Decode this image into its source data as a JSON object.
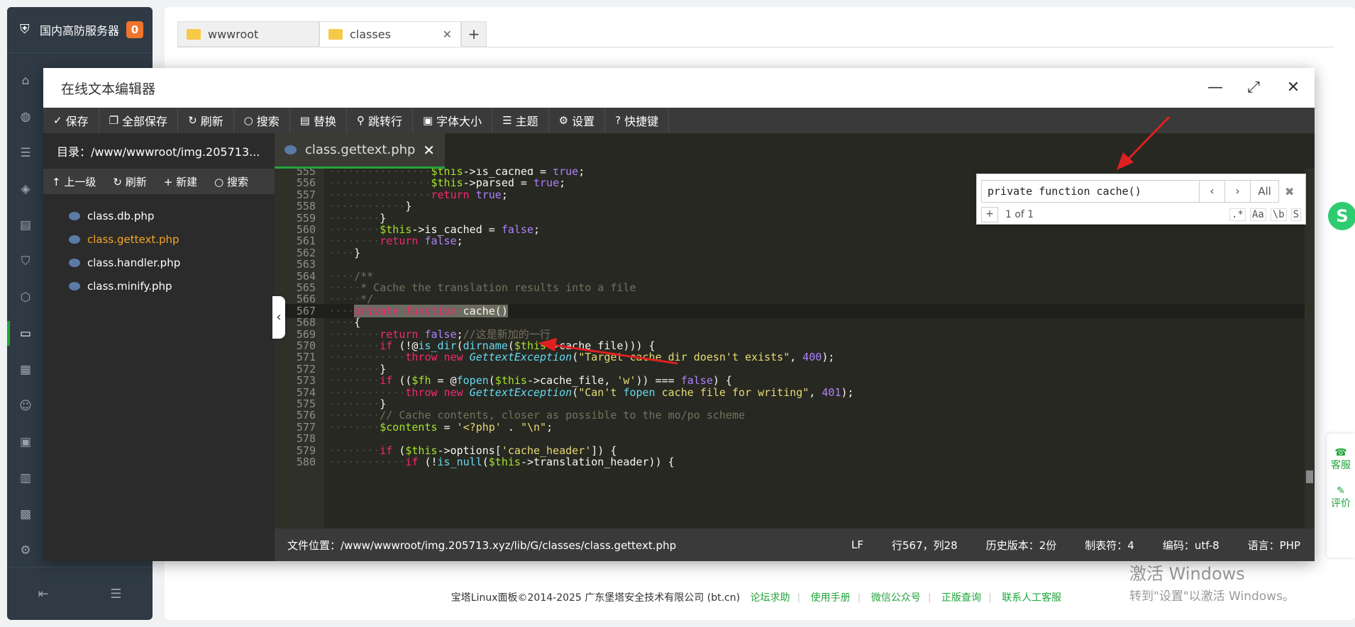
{
  "sidebar": {
    "brand_name": "国内高防服务器",
    "badge_count": "0"
  },
  "file_manager": {
    "tabs": [
      {
        "label": "wwwroot"
      },
      {
        "label": "classes"
      }
    ],
    "add_tab": "+"
  },
  "editor": {
    "title": "在线文本编辑器",
    "toolbar": {
      "save": "保存",
      "save_all": "全部保存",
      "refresh": "刷新",
      "search": "搜索",
      "replace": "替换",
      "goto_line": "跳转行",
      "font_size": "字体大小",
      "theme": "主题",
      "settings": "设置",
      "shortcuts": "快捷键"
    },
    "dir": {
      "path": "目录：/www/wwwroot/img.205713...",
      "up": "上一级",
      "refresh": "刷新",
      "new": "新建",
      "search": "搜索",
      "files": [
        "class.db.php",
        "class.gettext.php",
        "class.handler.php",
        "class.minify.php"
      ]
    },
    "active_tab": "class.gettext.php",
    "search_box": {
      "query": "private function cache()",
      "all_label": "All",
      "count": "1 of 1",
      "opt_regex": ".*",
      "opt_case": "Aa",
      "opt_word": "\\b",
      "opt_sel": "S"
    },
    "status": {
      "file_path": "文件位置：/www/wwwroot/img.205713.xyz/lib/G/classes/class.gettext.php",
      "line_ending": "LF",
      "cursor": "行567，列28",
      "history": "历史版本：2份",
      "tab_size": "制表符：4",
      "encoding": "编码：utf-8",
      "language": "语言：PHP"
    },
    "code_lines": [
      {
        "n": "555",
        "text": "                $this->is_cached = true;"
      },
      {
        "n": "556",
        "text": "                $this->parsed = true;"
      },
      {
        "n": "557",
        "text": "                return true;"
      },
      {
        "n": "558",
        "text": "            }"
      },
      {
        "n": "559",
        "text": "        }"
      },
      {
        "n": "560",
        "text": "        $this->is_cached = false;"
      },
      {
        "n": "561",
        "text": "        return false;"
      },
      {
        "n": "562",
        "text": "    }"
      },
      {
        "n": "563",
        "text": ""
      },
      {
        "n": "564",
        "text": "    /**"
      },
      {
        "n": "565",
        "text": "     * Cache the translation results into a file"
      },
      {
        "n": "566",
        "text": "     */"
      },
      {
        "n": "567",
        "text": "    private function cache()"
      },
      {
        "n": "568",
        "text": "    {"
      },
      {
        "n": "569",
        "text": "        return false;//这是新加的一行"
      },
      {
        "n": "570",
        "text": "        if (!@is_dir(dirname($this->cache_file))) {"
      },
      {
        "n": "571",
        "text": "            throw new GettextException(\"Target cache dir doesn't exists\", 400);"
      },
      {
        "n": "572",
        "text": "        }"
      },
      {
        "n": "573",
        "text": "        if (($fh = @fopen($this->cache_file, 'w')) === false) {"
      },
      {
        "n": "574",
        "text": "            throw new GettextException(\"Can't fopen cache file for writing\", 401);"
      },
      {
        "n": "575",
        "text": "        }"
      },
      {
        "n": "576",
        "text": "        // Cache contents, closer as possible to the mo/po scheme"
      },
      {
        "n": "577",
        "text": "        $contents = '<?php' . \"\\n\";"
      },
      {
        "n": "578",
        "text": ""
      },
      {
        "n": "579",
        "text": "        if ($this->options['cache_header']) {"
      },
      {
        "n": "580",
        "text": "            if (!is_null($this->translation_header)) {"
      }
    ]
  },
  "footer": {
    "copyright": "宝塔Linux面板©2014-2025 广东堡塔安全技术有限公司 (bt.cn)",
    "links": [
      "论坛求助",
      "使用手册",
      "微信公众号",
      "正版查询",
      "联系人工客服"
    ]
  },
  "watermark": {
    "line1": "激活 Windows",
    "line2": "转到\"设置\"以激活 Windows。"
  },
  "float_panel": {
    "service": "客服",
    "rate": "评价"
  }
}
